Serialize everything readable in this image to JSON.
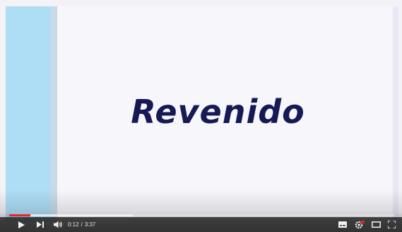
{
  "slide": {
    "title": "Revenido"
  },
  "player": {
    "current_time": "0:12",
    "separator": "/",
    "duration": "3:37",
    "played_fraction": 0.055,
    "buffered_fraction": 0.32,
    "accent_color": "#e4232a"
  },
  "icons": {
    "play": "play-icon",
    "next": "next-icon",
    "volume": "volume-icon",
    "subtitles": "subtitles-icon",
    "settings": "settings-icon",
    "theater": "theater-mode-icon",
    "fullscreen": "fullscreen-icon"
  }
}
